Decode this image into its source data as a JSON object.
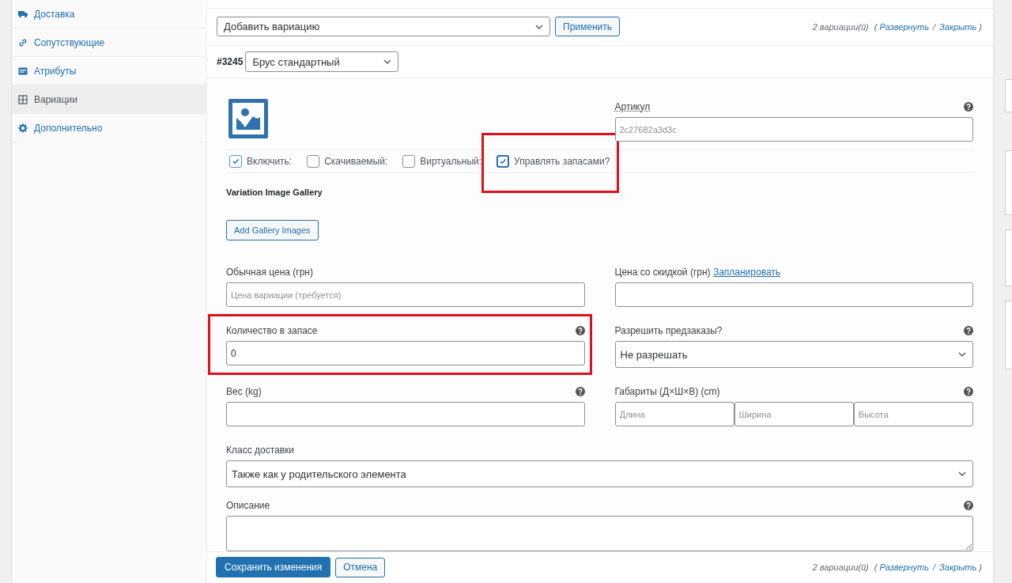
{
  "sidebar": {
    "items": [
      {
        "label": "Доставка",
        "selected": false
      },
      {
        "label": "Сопутствующие",
        "selected": false
      },
      {
        "label": "Атрибуты",
        "selected": false
      },
      {
        "label": "Вариации",
        "selected": true
      },
      {
        "label": "Дополнительно",
        "selected": false
      }
    ]
  },
  "toolbar": {
    "bulk_action": "Добавить вариацию",
    "apply_button": "Применить",
    "count": "2 вариации(й)",
    "paren_open": "(",
    "expand_link": "Развернуть",
    "separator": "/",
    "close_link": "Закрыть",
    "paren_close": ")"
  },
  "variation": {
    "number": "#3245",
    "attribute": "Брус стандартный",
    "sku": {
      "label": "Артикул",
      "placeholder": "2c27682a3d3c",
      "help": true
    },
    "options": [
      {
        "label": "Включить:",
        "checked": true,
        "highlighted": false
      },
      {
        "label": "Скачиваемый:",
        "checked": false,
        "highlighted": false
      },
      {
        "label": "Виртуальный:",
        "checked": false,
        "highlighted": false
      },
      {
        "label": "Управлять запасами?",
        "checked": true,
        "highlighted": true
      }
    ],
    "gallery_title": "Variation Image Gallery",
    "gallery_button": "Add Gallery Images",
    "regular_price": {
      "label": "Обычная цена (грн)",
      "placeholder": "Цена вариации (требуется)",
      "help": false
    },
    "sale_price": {
      "label": "Цена со скидкой (грн)",
      "link": "Запланировать",
      "help": false
    },
    "stock_quantity": {
      "label": "Количество в запасе",
      "value": "0",
      "help": true,
      "highlighted": true
    },
    "backorders": {
      "label": "Разрешить предзаказы?",
      "value": "Не разрешать",
      "help": true
    },
    "weight": {
      "label": "Вес (kg)",
      "help": true
    },
    "dimensions": {
      "label": "Габариты (Д×Ш×В) (cm)",
      "help": true,
      "placeholders": [
        "Длина",
        "Ширина",
        "Высота"
      ]
    },
    "shipping_class": {
      "label": "Класс доставки",
      "value": "Также как у родительского элемента",
      "help": false
    },
    "description": {
      "label": "Описание",
      "help": true
    }
  },
  "footer": {
    "save_button": "Сохранить изменения",
    "cancel_button": "Отмена",
    "count": "2 вариации(й)",
    "paren_open": "(",
    "expand_link": "Развернуть",
    "separator": "/",
    "close_link": "Закрыть",
    "paren_close": ")"
  }
}
